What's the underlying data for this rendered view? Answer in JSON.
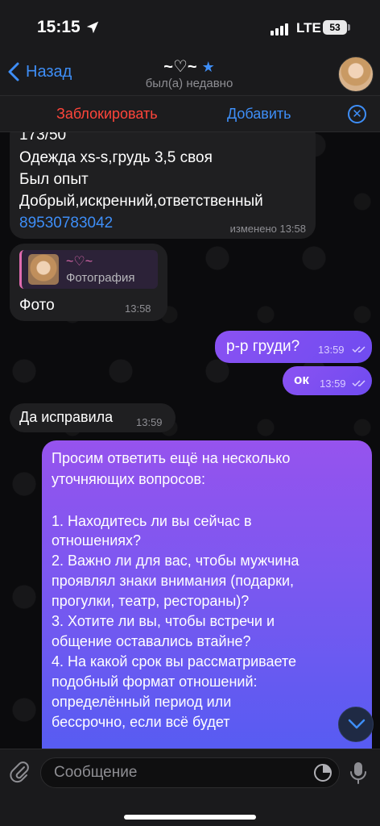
{
  "status_bar": {
    "time": "15:15",
    "network": "LTE",
    "battery": "53"
  },
  "header": {
    "back_label": "Назад",
    "chat_name": "~♡~",
    "chat_status": "был(а) недавно"
  },
  "action_bar": {
    "block_label": "Заблокировать",
    "add_label": "Добавить"
  },
  "messages": [
    {
      "direction": "in",
      "lines": [
        "173/50",
        "Одежда xs-s,грудь 3,5 своя",
        "Был опыт",
        "Добрый,искренний,ответственный"
      ],
      "phone": "89530783042",
      "time": "изменено 13:58"
    },
    {
      "direction": "in",
      "reply_name": "~♡~",
      "reply_text": "Фотография",
      "text": "Фото",
      "time": "13:58"
    },
    {
      "direction": "out",
      "text": "р-р груди?",
      "time": "13:59"
    },
    {
      "direction": "out",
      "text": "ок",
      "time": "13:59"
    },
    {
      "direction": "in",
      "text": "Да исправила",
      "time": "13:59"
    },
    {
      "direction": "out",
      "lines": [
        "Просим ответить ещё на несколько",
        "уточняющих вопросов:",
        "",
        "1. Находитесь ли вы сейчас в",
        "отношениях?",
        "2. Важно ли для вас, чтобы мужчина",
        "проявлял знаки внимания (подарки,",
        "прогулки, театр, рестораны)?",
        "3. Хотите ли вы, чтобы встречи и",
        "общение оставались втайне?",
        "4. На какой срок вы рассматриваете",
        "подобный формат отношений:",
        "определённый период или",
        "бессрочно, если всё будет"
      ]
    }
  ],
  "input": {
    "placeholder": "Сообщение"
  },
  "colors": {
    "accent": "#3e8ef7",
    "danger": "#ff453a",
    "outgoing": "#8b52f2"
  }
}
